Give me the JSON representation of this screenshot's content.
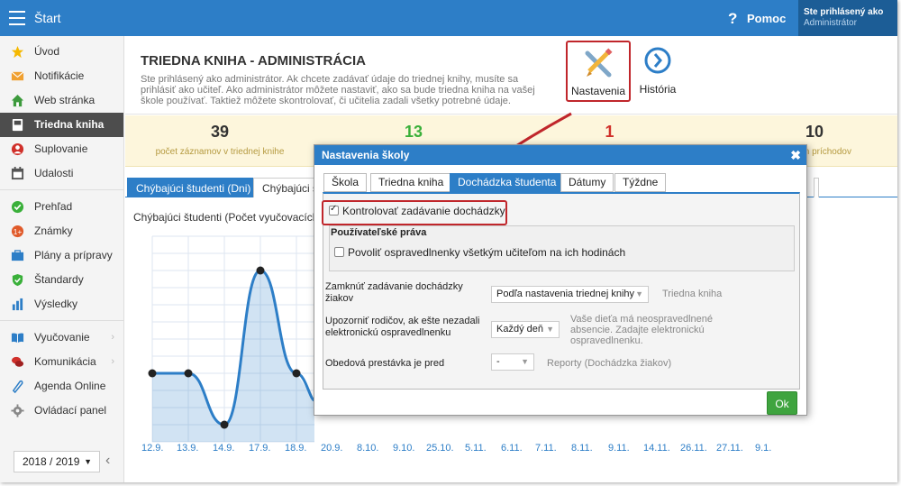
{
  "topbar": {
    "start": "Štart",
    "help": "Pomoc",
    "user_line1": "Ste prihlásený ako",
    "user_line2": "Administrátor"
  },
  "sidebar": {
    "items": [
      {
        "label": "Úvod",
        "icon": "star-icon",
        "color": "#f5b800"
      },
      {
        "label": "Notifikácie",
        "icon": "envelope-icon",
        "color": "#f0a030"
      },
      {
        "label": "Web stránka",
        "icon": "home-icon",
        "color": "#3c9a3c"
      },
      {
        "label": "Triedna kniha",
        "icon": "book-icon",
        "color": "#ffffff"
      },
      {
        "label": "Suplovanie",
        "icon": "person-icon",
        "color": "#d0302a"
      },
      {
        "label": "Udalosti",
        "icon": "calendar-icon",
        "color": "#555555"
      }
    ],
    "items2": [
      {
        "label": "Prehľad",
        "icon": "check-circle-icon",
        "color": "#3ab03a"
      },
      {
        "label": "Známky",
        "icon": "grade-icon",
        "color": "#e05a2a"
      },
      {
        "label": "Plány a prípravy",
        "icon": "briefcase-icon",
        "color": "#2d7ec7"
      },
      {
        "label": "Štandardy",
        "icon": "shield-icon",
        "color": "#3ab03a"
      },
      {
        "label": "Výsledky",
        "icon": "bar-chart-icon",
        "color": "#2d7ec7"
      }
    ],
    "items3": [
      {
        "label": "Vyučovanie",
        "icon": "open-book-icon",
        "color": "#2d7ec7"
      },
      {
        "label": "Komunikácia",
        "icon": "chat-icon",
        "color": "#d0302a"
      },
      {
        "label": "Agenda Online",
        "icon": "pen-icon",
        "color": "#2d7ec7"
      },
      {
        "label": "Ovládací panel",
        "icon": "gear-icon",
        "color": "#888888"
      }
    ],
    "year": "2018 / 2019"
  },
  "header": {
    "title": "TRIEDNA KNIHA - ADMINISTRÁCIA",
    "description": "Ste prihlásený ako administrátor. Ak chcete zadávať údaje do triednej knihy, musíte sa prihlásiť ako učiteľ. Ako administrátor môžete nastaviť, ako sa bude triedna kniha na vašej škole používať. Taktiež môžete skontrolovať, či učitelia zadali všetky potrebné údaje.",
    "settings_label": "Nastavenia",
    "history_label": "História"
  },
  "stats": [
    {
      "value": "39",
      "label": "počet záznamov v triednej knihe",
      "color": "#333333"
    },
    {
      "value": "13",
      "label": "",
      "color": "#3ab03a"
    },
    {
      "value": "1",
      "label": "",
      "color": "#d0302a"
    },
    {
      "value": "10",
      "label": "ch príchodov",
      "color": "#333333"
    }
  ],
  "tabs": [
    "Chýbajúci študenti (Dni)",
    "Chýbajúci št"
  ],
  "chart_data": {
    "type": "area",
    "title": "Chýbajúci študenti (Počet vyučovacích ho",
    "categories": [
      "12.9.",
      "13.9.",
      "14.9.",
      "17.9.",
      "18.9.",
      "20.9.",
      "8.10.",
      "9.10.",
      "25.10.",
      "5.11.",
      "6.11.",
      "7.11.",
      "8.11.",
      "9.11.",
      "14.11.",
      "26.11.",
      "27.11.",
      "9.1."
    ],
    "visible_points": [
      {
        "x": "12.9.",
        "y": 4
      },
      {
        "x": "13.9.",
        "y": 4
      },
      {
        "x": "14.9.",
        "y": 1
      },
      {
        "x": "17.9.",
        "y": 10
      },
      {
        "x": "18.9.",
        "y": 4
      }
    ],
    "ylim": [
      0,
      12
    ],
    "grid": true,
    "color": "#2d7ec7"
  },
  "dialog": {
    "title": "Nastavenia školy",
    "tabs": [
      "Škola",
      "Triedna kniha",
      "Dochádzka študenta",
      "Dátumy",
      "Týždne"
    ],
    "check_attendance": "Kontrolovať zadávanie dochádzky",
    "rights_title": "Používateľské práva",
    "allow_excuse": "Povoliť ospravedlnenky všetkým učiteľom na ich hodinách",
    "lock_label": "Zamknúť zadávanie dochádzky žiakov",
    "lock_value": "Podľa nastavenia triednej knihy",
    "lock_help": "Triedna kniha",
    "notify_label": "Upozorniť rodičov, ak ešte nezadali elektronickú ospravedlnenku",
    "notify_value": "Každý deň",
    "notify_help": "Vaše dieťa má neospravedlnené absencie. Zadajte elektronickú ospravedlnenku.",
    "lunch_label": "Obedová prestávka je pred",
    "lunch_value": "-",
    "lunch_help": "Reporty (Dochádzka žiakov)",
    "ok": "Ok"
  }
}
